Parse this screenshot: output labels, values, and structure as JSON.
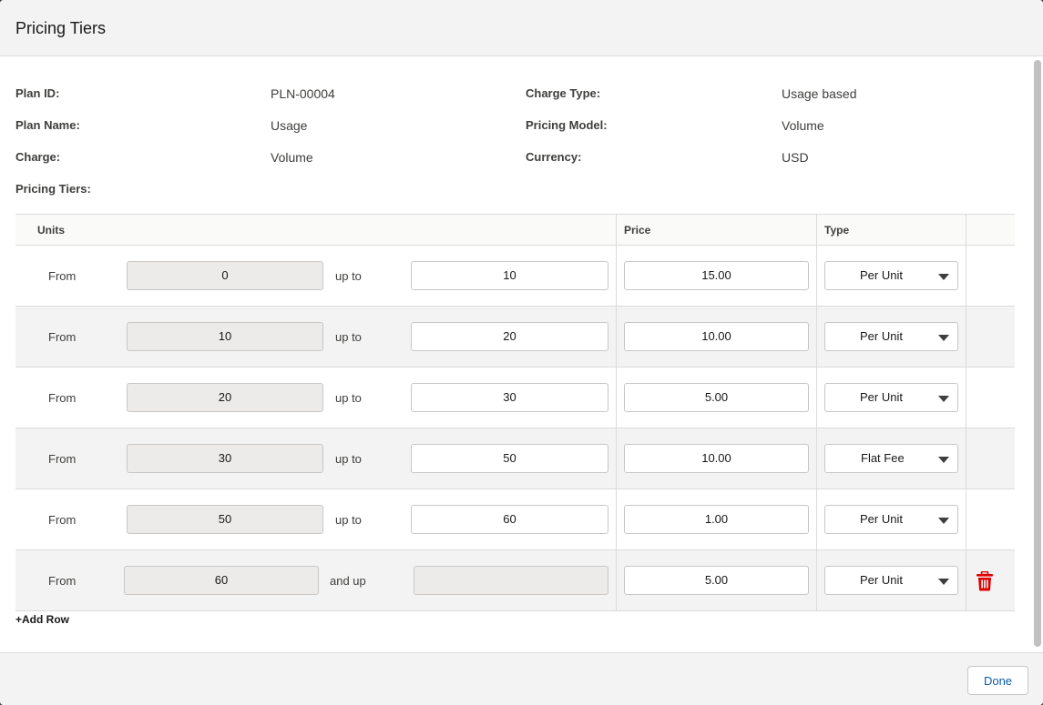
{
  "modal": {
    "title": "Pricing Tiers"
  },
  "info": {
    "plan_id_label": "Plan ID:",
    "plan_id": "PLN-00004",
    "charge_type_label": "Charge Type:",
    "charge_type": "Usage based",
    "plan_name_label": "Plan Name:",
    "plan_name": "Usage",
    "pricing_model_label": "Pricing Model:",
    "pricing_model": "Volume",
    "charge_label": "Charge:",
    "charge": "Volume",
    "currency_label": "Currency:",
    "currency": "USD",
    "pricing_tiers_label": "Pricing Tiers:"
  },
  "table": {
    "headers": {
      "units": "Units",
      "price": "Price",
      "type": "Type"
    },
    "rows": [
      {
        "from_label": "From",
        "from": "0",
        "to_label": "up to",
        "to": "10",
        "price": "15.00",
        "type": "Per Unit"
      },
      {
        "from_label": "From",
        "from": "10",
        "to_label": "up to",
        "to": "20",
        "price": "10.00",
        "type": "Per Unit"
      },
      {
        "from_label": "From",
        "from": "20",
        "to_label": "up to",
        "to": "30",
        "price": "5.00",
        "type": "Per Unit"
      },
      {
        "from_label": "From",
        "from": "30",
        "to_label": "up to",
        "to": "50",
        "price": "10.00",
        "type": "Flat Fee"
      },
      {
        "from_label": "From",
        "from": "50",
        "to_label": "up to",
        "to": "60",
        "price": "1.00",
        "type": "Per Unit"
      },
      {
        "from_label": "From",
        "from": "60",
        "to_label": "and up",
        "to": "",
        "price": "5.00",
        "type": "Per Unit"
      }
    ]
  },
  "add_row_label": "+Add Row",
  "footer": {
    "done_label": "Done"
  },
  "colors": {
    "delete_icon": "#e00000",
    "done_text": "#0b5cab"
  }
}
